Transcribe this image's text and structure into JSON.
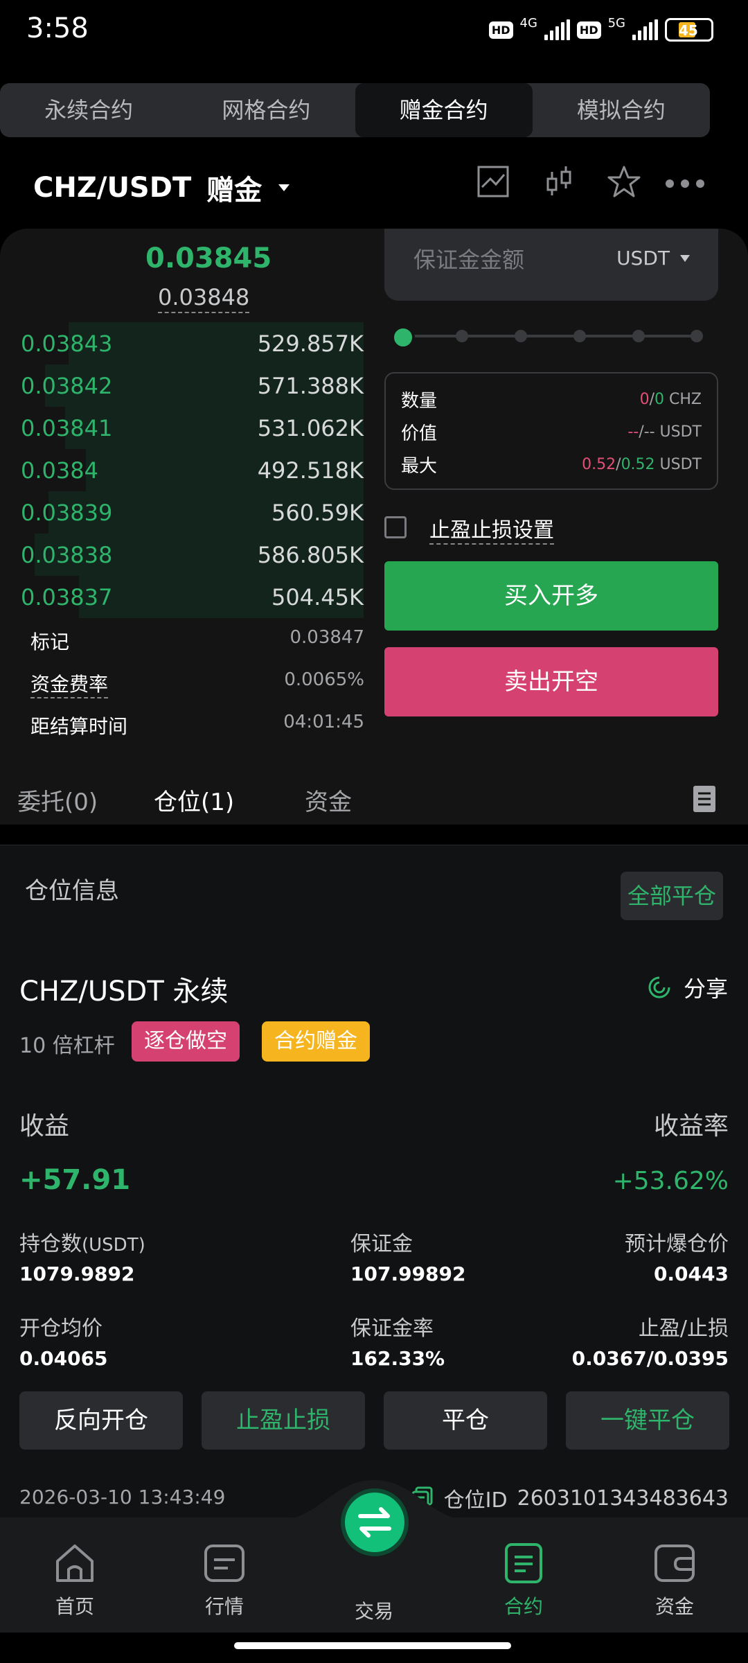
{
  "status_bar": {
    "time": "3:58",
    "net1": "4G",
    "net2": "5G",
    "battery": "45",
    "hd": "HD"
  },
  "contract_tabs": [
    "永续合约",
    "网格合约",
    "赠金合约",
    "模拟合约"
  ],
  "active_tab_index": 2,
  "header": {
    "pair": "CHZ/USDT",
    "mode": "赠金"
  },
  "orderbook": {
    "last_price": "0.03845",
    "mark_sub": "0.03848",
    "rows": [
      {
        "price": "0.03843",
        "size": "529.857K",
        "depth": 0.86
      },
      {
        "price": "0.03842",
        "size": "571.388K",
        "depth": 0.93
      },
      {
        "price": "0.03841",
        "size": "531.062K",
        "depth": 0.87
      },
      {
        "price": "0.0384",
        "size": "492.518K",
        "depth": 0.81
      },
      {
        "price": "0.03839",
        "size": "560.59K",
        "depth": 0.92
      },
      {
        "price": "0.03838",
        "size": "586.805K",
        "depth": 0.96
      },
      {
        "price": "0.03837",
        "size": "504.45K",
        "depth": 0.83
      }
    ],
    "mark_label": "标记",
    "mark_value": "0.03847",
    "funding_label": "资金费率",
    "funding_value": "0.0065%",
    "settle_label": "距结算时间",
    "settle_value": "04:01:45"
  },
  "order_form": {
    "margin_placeholder": "保证金金额",
    "currency": "USDT",
    "slider_percent": 0,
    "qty_label": "数量",
    "qty_a": "0",
    "qty_sep": "/",
    "qty_b": "0",
    "qty_unit": "CHZ",
    "value_label": "价值",
    "value_a": "--",
    "value_b": "--",
    "value_unit": "USDT",
    "max_label": "最大",
    "max_a": "0.52",
    "max_b": "0.52",
    "max_unit": "USDT",
    "tpsl_label": "止盈止损设置",
    "buy_label": "买入开多",
    "sell_label": "卖出开空"
  },
  "lower_tabs": {
    "orders": "委托(0)",
    "positions": "仓位(1)",
    "funds": "资金"
  },
  "position": {
    "section_title": "仓位信息",
    "close_all": "全部平仓",
    "pair": "CHZ/USDT 永续",
    "share": "分享",
    "leverage": "10 倍杠杆",
    "tag_side": "逐仓做空",
    "tag_bonus": "合约赠金",
    "pnl_label": "收益",
    "pnl_value": "+57.91",
    "roe_label": "收益率",
    "roe_value": "+53.62%",
    "size_label": "持仓数",
    "size_unit": "(USDT)",
    "size_value": "1079.9892",
    "margin_label": "保证金",
    "margin_value": "107.99892",
    "liq_label": "预计爆仓价",
    "liq_value": "0.0443",
    "entry_label": "开仓均价",
    "entry_value": "0.04065",
    "mratio_label": "保证金率",
    "mratio_value": "162.33%",
    "tpsl_label": "止盈/止损",
    "tpsl_value": "0.0367/0.0395",
    "btn_reverse": "反向开仓",
    "btn_tpsl": "止盈止损",
    "btn_close": "平仓",
    "btn_quick_close": "一键平仓",
    "time": "2026-03-10 13:43:49",
    "pos_id_label": "仓位ID",
    "pos_id": "2603101343483643"
  },
  "nav": {
    "home": "首页",
    "market": "行情",
    "trade": "交易",
    "futures": "合约",
    "assets": "资金"
  },
  "colors": {
    "green": "#2fb46b",
    "pink": "#e44f77",
    "gold": "#f6b51e",
    "buy": "#27a652",
    "sell": "#d54271"
  }
}
